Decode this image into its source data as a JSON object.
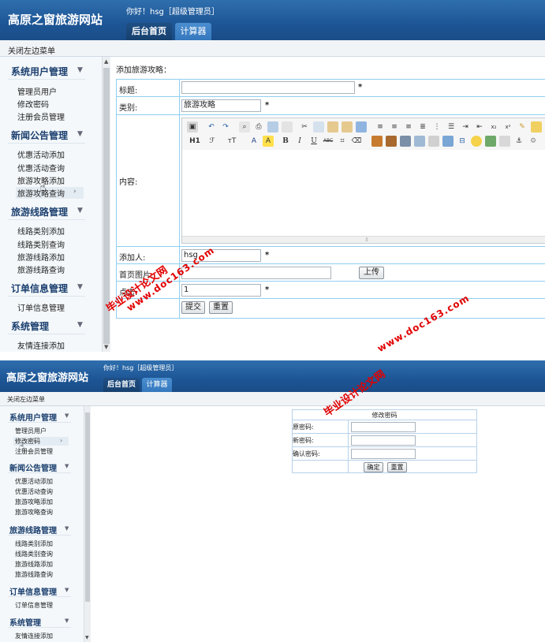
{
  "site_title": "高原之窗旅游网站",
  "greeting": "你好！hsg［超级管理员］",
  "tabs": [
    {
      "label": "后台首页",
      "active": true
    },
    {
      "label": "计算器",
      "active": false
    }
  ],
  "close_menu": "关闭左边菜单",
  "sidebar": {
    "groups": [
      {
        "title": "系统用户管理",
        "items": [
          "管理员用户",
          "修改密码",
          "注册会员管理"
        ]
      },
      {
        "title": "新闻公告管理",
        "items": [
          "优惠活动添加",
          "优惠活动查询",
          "旅游攻略添加",
          "旅游攻略查询"
        ]
      },
      {
        "title": "旅游线路管理",
        "items": [
          "线路类别添加",
          "线路类别查询",
          "旅游线路添加",
          "旅游线路查询"
        ]
      },
      {
        "title": "订单信息管理",
        "items": [
          "订单信息管理"
        ]
      },
      {
        "title": "系统管理",
        "items": [
          "友情连接添加"
        ]
      }
    ]
  },
  "form": {
    "heading": "添加旅游攻略：",
    "title_label": "标题:",
    "title_value": "",
    "category_label": "类别:",
    "category_value": "旅游攻略",
    "content_label": "内容:",
    "adder_label": "添加人:",
    "adder_value": "hsg",
    "image_label": "首页图片:",
    "upload_button": "上传",
    "clicks_label": "点击:",
    "clicks_value": "1",
    "required_mark": "*",
    "submit_button": "提交",
    "reset_button": "重置"
  },
  "editor_toolbar": {
    "row1": [
      "source",
      "undo",
      "redo",
      "preview",
      "print",
      "template",
      "cut",
      "copy",
      "paste",
      "paste-text",
      "paste-word",
      "justify-left",
      "justify-center",
      "justify-right",
      "justify-full",
      "ordered-list",
      "unordered-list",
      "indent",
      "outdent",
      "subscript",
      "superscript",
      "clear-format"
    ],
    "row2_text": [
      "H1",
      "ℱ",
      "тT",
      "A",
      "A",
      "B",
      "I",
      "U",
      "ABC"
    ],
    "row2_icons": [
      "image",
      "flash",
      "media",
      "table",
      "hr",
      "emoticon",
      "special-char",
      "page-break",
      "anchor"
    ]
  },
  "password_form": {
    "caption": "修改密码",
    "old_label": "原密码:",
    "new_label": "新密码:",
    "confirm_label": "确认密码:",
    "ok_button": "确定",
    "reset_button": "重置"
  },
  "watermark": {
    "cn": "毕业设计论文网",
    "url": "www.doc163.com"
  },
  "colors": {
    "header": "#1d5595",
    "tab_active": "#1f4f85",
    "tab_inactive": "#3f86cc",
    "table_border": "#8fd0f0",
    "watermark": "#e10000"
  }
}
